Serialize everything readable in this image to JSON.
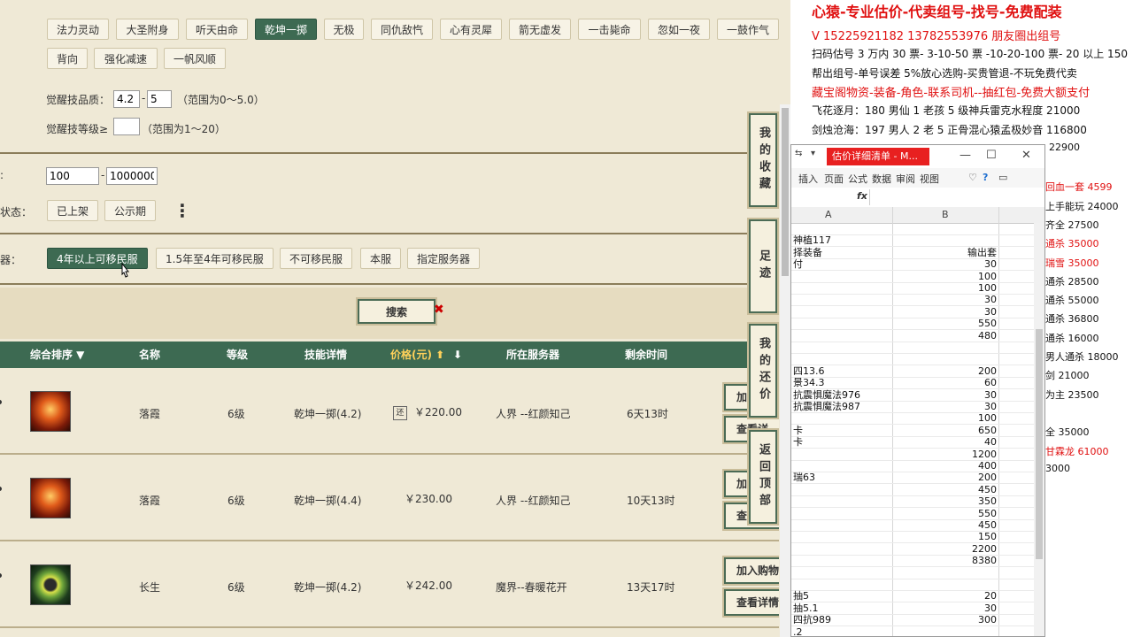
{
  "skill_tags_row1": [
    "法力灵动",
    "大圣附身",
    "听天由命",
    "乾坤一掷",
    "无极",
    "同仇敌忾",
    "心有灵犀",
    "箭无虚发",
    "一击毙命",
    "忽如一夜",
    "一鼓作气"
  ],
  "skill_tags_row2": [
    "背向",
    "强化减速",
    "一帆风顺"
  ],
  "filters": {
    "quality_label": "觉醒技品质：",
    "quality_min": "4.2",
    "quality_sep": "-",
    "quality_max": "5",
    "quality_range": "（范围为0～5.0）",
    "level_label": "觉醒技等级≥",
    "level_value": "",
    "level_range": "（范围为1～20）",
    "price_label": ":",
    "price_min": "100",
    "price_sep": "-",
    "price_max": "1000000",
    "status_label": "状态：",
    "status_options": [
      "已上架",
      "公示期"
    ],
    "more_icon": "⋮",
    "server_label": "器：",
    "server_options": [
      "4年以上可移民服",
      "1.5年至4年可移民服",
      "不可移民服",
      "本服",
      "指定服务器"
    ],
    "search_label": "搜索",
    "search_clear": "✖"
  },
  "table": {
    "headers": {
      "sort": "综合排序 ▼",
      "name": "名称",
      "level": "等级",
      "skill": "技能详情",
      "price": "价格(元) ⬆",
      "price_down": "⬇",
      "server": "所在服务器",
      "time": "剩余时间"
    },
    "rows": [
      {
        "icon": "fire",
        "name": "落霞",
        "level": "6级",
        "skill": "乾坤一掷(4.2)",
        "badge": "还",
        "price": "￥220.00",
        "server": "人界 --红颜知己",
        "time": "6天13时",
        "btn1": "加",
        "btn2": "查看详"
      },
      {
        "icon": "fire",
        "name": "落霞",
        "level": "6级",
        "skill": "乾坤一掷(4.4)",
        "badge": "",
        "price": "￥230.00",
        "server": "人界 --红颜知己",
        "time": "10天13时",
        "btn1": "加",
        "btn2": "查"
      },
      {
        "icon": "ring",
        "name": "长生",
        "level": "6级",
        "skill": "乾坤一掷(4.2)",
        "badge": "",
        "price": "￥242.00",
        "server": "魔界--春暖花开",
        "time": "13天17时",
        "btn1": "加入购物",
        "btn2": "查看详情"
      }
    ]
  },
  "side_buttons": {
    "favorites": "我的收藏",
    "footprint": "足迹",
    "my_offer": "我的还价",
    "back_top": "返回顶部"
  },
  "right_panel": {
    "title": "心猿-专业估价-代卖组号-找号-免费配装",
    "contact": "V 15225921182   13782553976 朋友圈出组号",
    "lines": [
      {
        "text": "扫码估号 3 万内 30 票- 3-10-50 票  -10-20-100 票- 20 以上 150",
        "red": false
      },
      {
        "text": "帮出组号-单号误差 5%放心选购-买贵管退-不玩免费代卖",
        "red": false
      },
      {
        "text": "藏宝阁物资-装备-角色-联系司机--抽红包-免费大额支付",
        "red": true
      },
      {
        "text": "飞花逐月：180 男仙 1 老孩 5 级神兵雷克水程度 21000",
        "red": false
      },
      {
        "text": "剑烛沧海：197 男人 2 老 5 正骨混心猿孟极妙音 116800",
        "red": false
      },
      {
        "text": "22900",
        "red": false
      }
    ],
    "right_fragments": [
      {
        "text": "回血一套 4599",
        "red": true
      },
      {
        "text": "上手能玩 24000",
        "red": false
      },
      {
        "text": "齐全 27500",
        "red": false
      },
      {
        "text": "通杀 35000",
        "red": true
      },
      {
        "text": "瑞雪 35000",
        "red": true
      },
      {
        "text": "通杀 28500",
        "red": false
      },
      {
        "text": "通杀 55000",
        "red": false
      },
      {
        "text": "通杀 36800",
        "red": false
      },
      {
        "text": "通杀 16000",
        "red": false
      },
      {
        "text": "男人通杀 18000",
        "red": false
      },
      {
        "text": "剑 21000",
        "red": false
      },
      {
        "text": "为主 23500",
        "red": false
      },
      {
        "text": "全 35000",
        "red": false
      },
      {
        "text": "甘霖龙 61000",
        "red": true
      },
      {
        "text": "3000",
        "red": false
      }
    ]
  },
  "excel": {
    "tab_title": "估价详细清单 - M...",
    "ctrl_min": "—",
    "ctrl_max": "☐",
    "ctrl_close": "✕",
    "ribbon": [
      "插入",
      "页面",
      "公式",
      "数据",
      "审阅",
      "视图"
    ],
    "fx": "fx",
    "col_a": "A",
    "col_b": "B",
    "rows": [
      [
        "",
        ""
      ],
      [
        "神植117",
        ""
      ],
      [
        "择装备",
        "输出套"
      ],
      [
        "付",
        "30"
      ],
      [
        "",
        "100"
      ],
      [
        "",
        "100"
      ],
      [
        "",
        "30"
      ],
      [
        "",
        "30"
      ],
      [
        "",
        "550"
      ],
      [
        "",
        "480"
      ],
      [
        "",
        ""
      ],
      [
        "",
        ""
      ],
      [
        "四13.6",
        "200"
      ],
      [
        "景34.3",
        "60"
      ],
      [
        "抗震惧魔法976",
        "30"
      ],
      [
        "抗震惧魔法987",
        "30"
      ],
      [
        "",
        "100"
      ],
      [
        "卡",
        "650"
      ],
      [
        "卡",
        "40"
      ],
      [
        "",
        "1200"
      ],
      [
        "",
        "400"
      ],
      [
        "瑞63",
        "200"
      ],
      [
        "",
        "450"
      ],
      [
        "",
        "350"
      ],
      [
        "",
        "550"
      ],
      [
        "",
        "450"
      ],
      [
        "",
        "150"
      ],
      [
        "",
        "2200"
      ],
      [
        "",
        "8380"
      ],
      [
        "",
        ""
      ],
      [
        "",
        ""
      ],
      [
        "抽5",
        "20"
      ],
      [
        "抽5.1",
        "30"
      ],
      [
        "四抗989",
        "300"
      ],
      [
        ".2",
        ""
      ]
    ]
  }
}
